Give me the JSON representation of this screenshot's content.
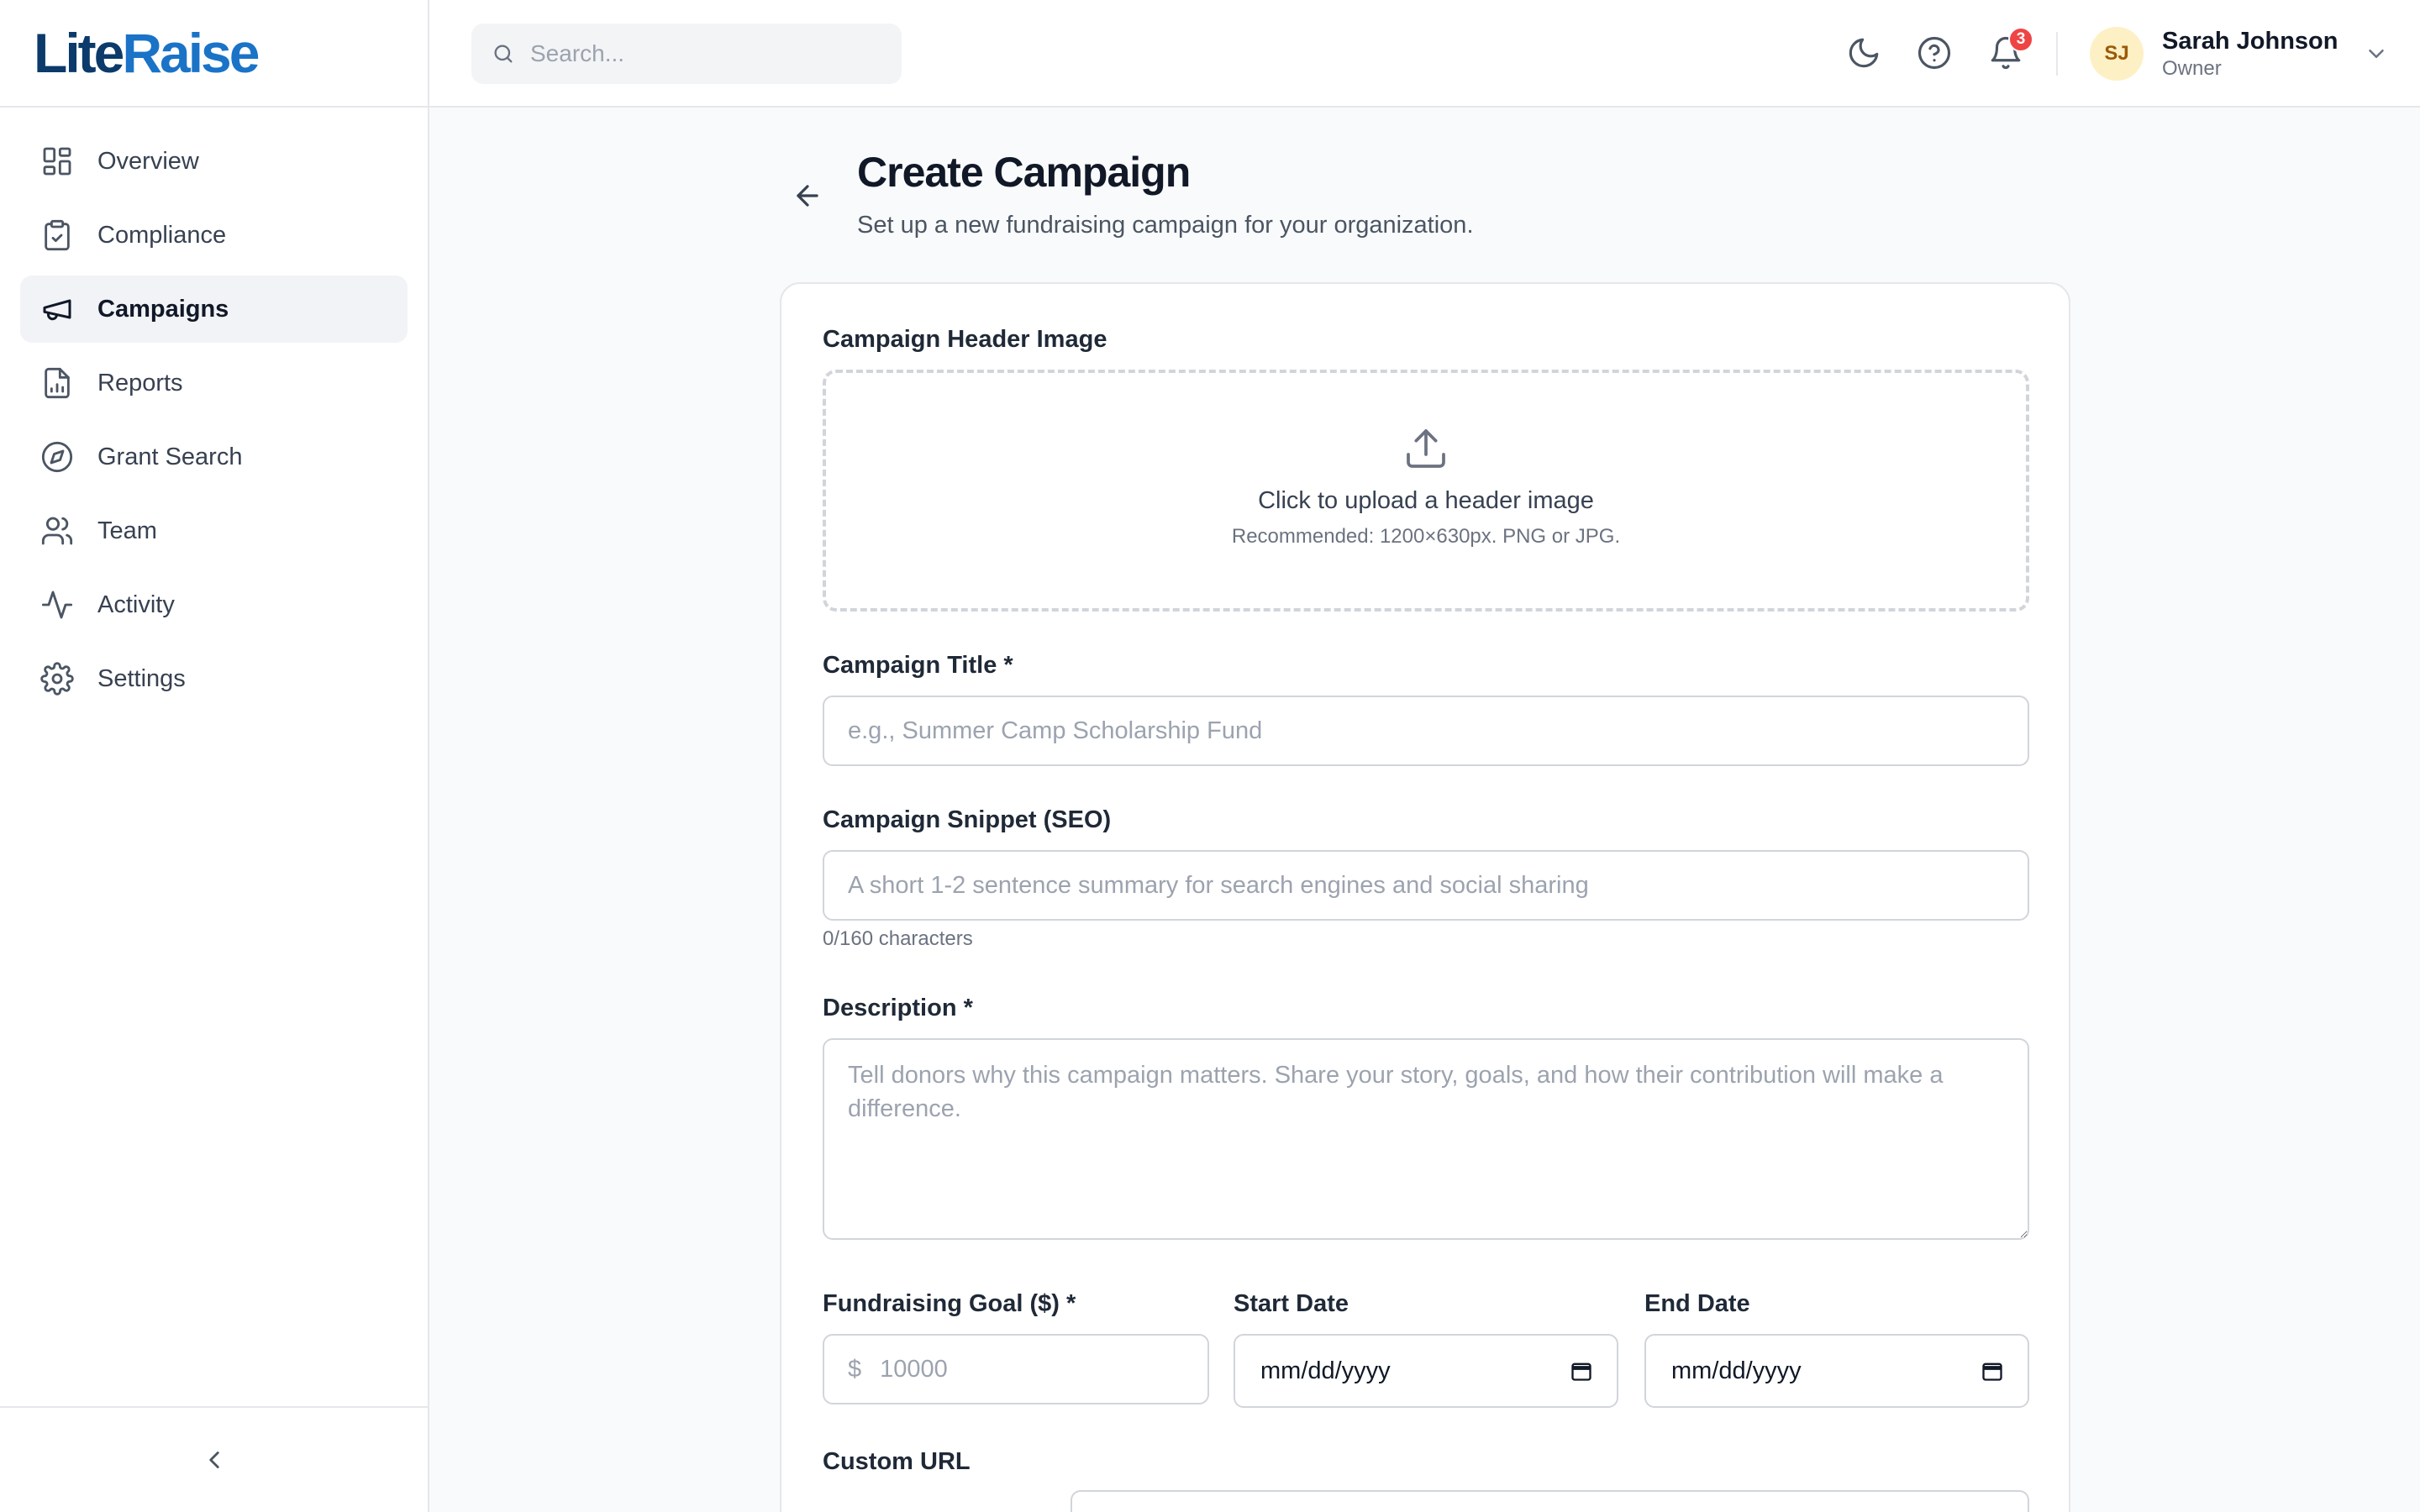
{
  "brand": {
    "logo_part1": "Lite",
    "logo_part2": "Raise"
  },
  "sidebar": {
    "items": [
      {
        "label": "Overview",
        "icon": "grid-icon",
        "active": false
      },
      {
        "label": "Compliance",
        "icon": "clipboard-check-icon",
        "active": false
      },
      {
        "label": "Campaigns",
        "icon": "megaphone-icon",
        "active": true
      },
      {
        "label": "Reports",
        "icon": "file-chart-icon",
        "active": false
      },
      {
        "label": "Grant Search",
        "icon": "compass-icon",
        "active": false
      },
      {
        "label": "Team",
        "icon": "users-icon",
        "active": false
      },
      {
        "label": "Activity",
        "icon": "activity-icon",
        "active": false
      },
      {
        "label": "Settings",
        "icon": "gear-icon",
        "active": false
      }
    ],
    "collapse_icon": "chevron-left-icon"
  },
  "header": {
    "search_placeholder": "Search...",
    "notification_count": "3",
    "user": {
      "initials": "SJ",
      "name": "Sarah Johnson",
      "role": "Owner"
    }
  },
  "page": {
    "title": "Create Campaign",
    "subtitle": "Set up a new fundraising campaign for your organization."
  },
  "form": {
    "header_image": {
      "label": "Campaign Header Image",
      "upload_title": "Click to upload a header image",
      "upload_hint": "Recommended: 1200×630px. PNG or JPG."
    },
    "title": {
      "label": "Campaign Title *",
      "placeholder": "e.g., Summer Camp Scholarship Fund"
    },
    "snippet": {
      "label": "Campaign Snippet (SEO)",
      "placeholder": "A short 1-2 sentence summary for search engines and social sharing",
      "counter": "0/160 characters"
    },
    "description": {
      "label": "Description *",
      "placeholder": "Tell donors why this campaign matters. Share your story, goals, and how their contribution will make a difference."
    },
    "goal": {
      "label": "Fundraising Goal ($) *",
      "currency": "$",
      "placeholder": "10000"
    },
    "start_date": {
      "label": "Start Date",
      "placeholder": "mm/dd/yyyy"
    },
    "end_date": {
      "label": "End Date",
      "placeholder": "mm/dd/yyyy"
    },
    "custom_url": {
      "label": "Custom URL"
    }
  },
  "colors": {
    "brand_dark": "#0b3a6b",
    "brand_light": "#1a73c7",
    "badge": "#ef4444",
    "avatar_bg": "#fdf0c4"
  }
}
